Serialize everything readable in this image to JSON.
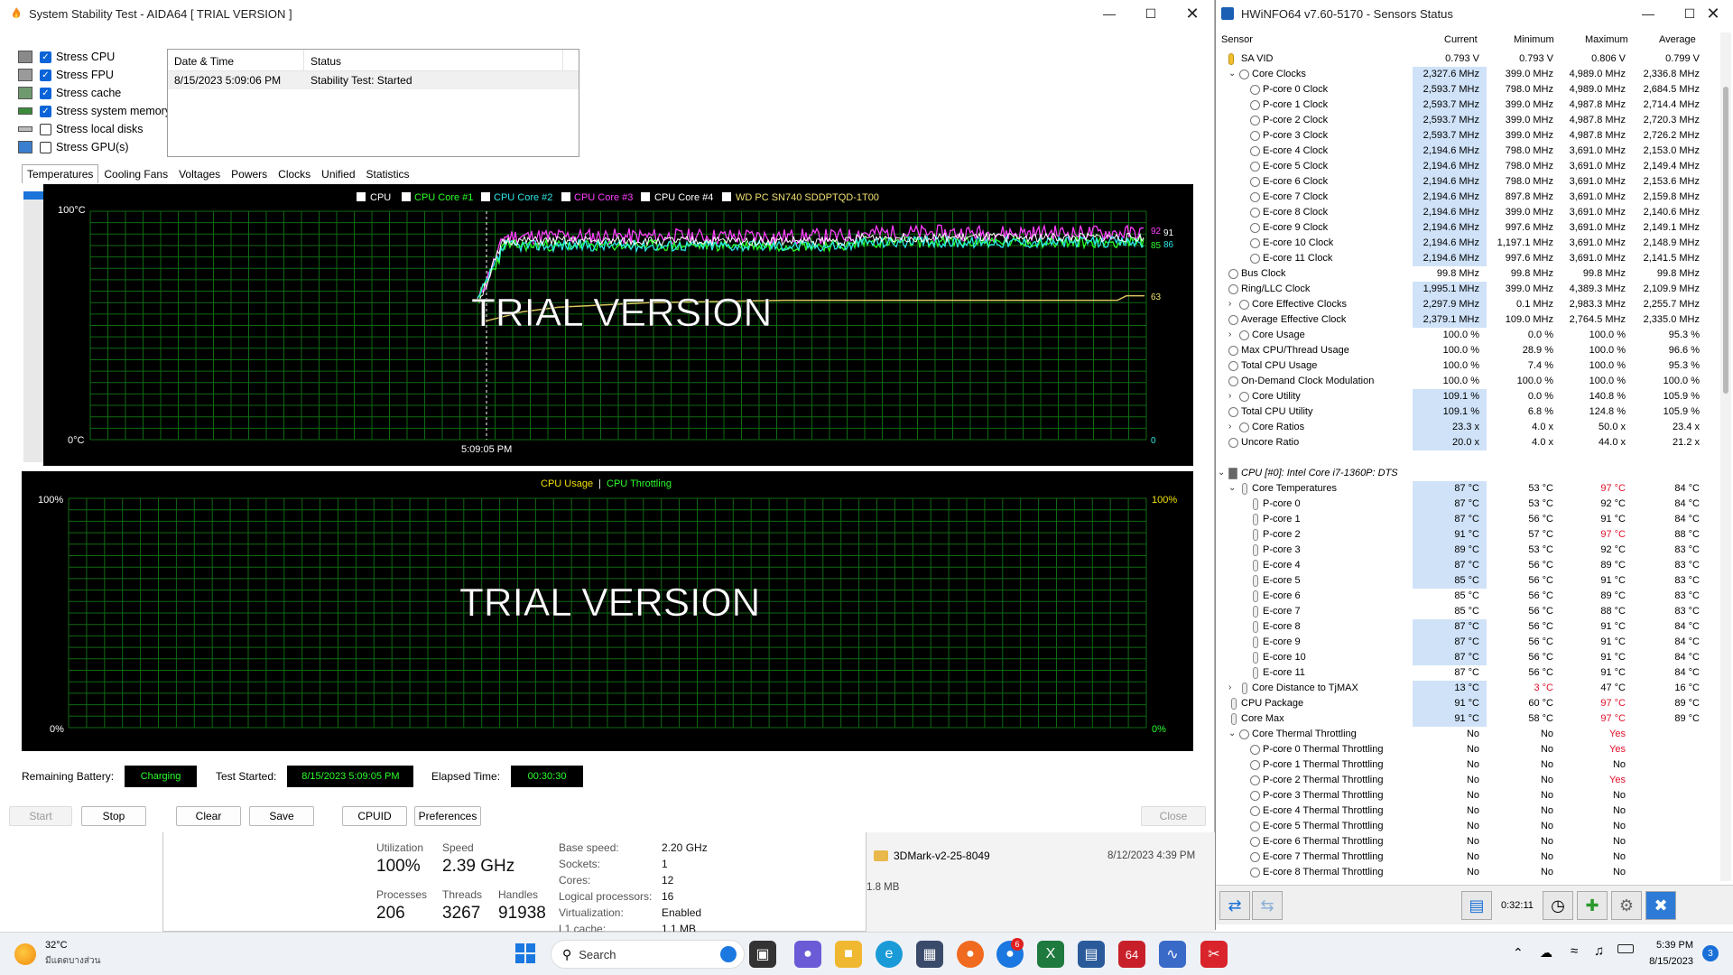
{
  "aida": {
    "title": "System Stability Test - AIDA64  [ TRIAL VERSION ]",
    "stress": [
      {
        "label": "Stress CPU",
        "checked": true
      },
      {
        "label": "Stress FPU",
        "checked": true
      },
      {
        "label": "Stress cache",
        "checked": true
      },
      {
        "label": "Stress system memory",
        "checked": true
      },
      {
        "label": "Stress local disks",
        "checked": false
      },
      {
        "label": "Stress GPU(s)",
        "checked": false
      }
    ],
    "log": {
      "col1": "Date & Time",
      "col2": "Status",
      "row_date": "8/15/2023 5:09:06 PM",
      "row_status": "Stability Test: Started"
    },
    "tabs": [
      "Temperatures",
      "Cooling Fans",
      "Voltages",
      "Powers",
      "Clocks",
      "Unified",
      "Statistics"
    ],
    "graph1": {
      "legend": [
        "CPU",
        "CPU Core #1",
        "CPU Core #2",
        "CPU Core #3",
        "CPU Core #4",
        "WD PC SN740 SDDPTQD-1T00"
      ],
      "legend_colors": [
        "#ffffff",
        "#2bff2b",
        "#2ee6e6",
        "#ff40ff",
        "#ffffff",
        "#f0e070"
      ],
      "y_top": "100°C",
      "y_bottom": "0°C",
      "x_label": "5:09:05 PM",
      "right_labels": {
        "a": "92",
        "b": "91",
        "c": "85",
        "d": "86",
        "e": "63",
        "f": "0"
      },
      "watermark": "TRIAL VERSION"
    },
    "graph2": {
      "legend_a": "CPU Usage",
      "legend_sep": "|",
      "legend_b": "CPU Throttling",
      "y_top_left": "100%",
      "y_bottom_left": "0%",
      "y_top_right": "100%",
      "y_bottom_right": "0%",
      "watermark": "TRIAL VERSION"
    },
    "status": {
      "battery_label": "Remaining Battery:",
      "battery_value": "Charging",
      "started_label": "Test Started:",
      "started_value": "8/15/2023 5:09:05 PM",
      "elapsed_label": "Elapsed Time:",
      "elapsed_value": "00:30:30"
    },
    "buttons": {
      "start": "Start",
      "stop": "Stop",
      "clear": "Clear",
      "save": "Save",
      "cpuid": "CPUID",
      "preferences": "Preferences",
      "close": "Close"
    }
  },
  "taskmgr": {
    "utilization_label": "Utilization",
    "utilization": "100%",
    "speed_label": "Speed",
    "speed": "2.39 GHz",
    "processes_label": "Processes",
    "processes": "206",
    "threads_label": "Threads",
    "threads": "3267",
    "handles_label": "Handles",
    "handles": "91938",
    "base_speed_k": "Base speed:",
    "base_speed_v": "2.20 GHz",
    "sockets_k": "Sockets:",
    "sockets_v": "1",
    "cores_k": "Cores:",
    "cores_v": "12",
    "logical_k": "Logical processors:",
    "logical_v": "16",
    "virt_k": "Virtualization:",
    "virt_v": "Enabled",
    "l1_k": "L1 cache:",
    "l1_v": "1.1 MB"
  },
  "explorer": {
    "file_name": "3DMark-v2-25-8049",
    "file_date": "8/12/2023 4:39 PM",
    "size": "1.8 MB"
  },
  "hwinfo": {
    "title": "HWiNFO64 v7.60-5170 - Sensors Status",
    "headers": {
      "sensor": "Sensor",
      "current": "Current",
      "minimum": "Minimum",
      "maximum": "Maximum",
      "average": "Average"
    },
    "rows": [
      {
        "n": "SA VID",
        "c": "0.793 V",
        "mi": "0.793 V",
        "ma": "0.806 V",
        "a": "0.799 V",
        "ind": 0,
        "t": "v"
      },
      {
        "n": "Core Clocks",
        "c": "2,327.6 MHz",
        "mi": "399.0 MHz",
        "ma": "4,989.0 MHz",
        "a": "2,336.8 MHz",
        "ind": 1,
        "t": "s",
        "e": "v",
        "hl": true
      },
      {
        "n": "P-core 0 Clock",
        "c": "2,593.7 MHz",
        "mi": "798.0 MHz",
        "ma": "4,989.0 MHz",
        "a": "2,684.5 MHz",
        "ind": 2,
        "t": "s",
        "hl": true
      },
      {
        "n": "P-core 1 Clock",
        "c": "2,593.7 MHz",
        "mi": "399.0 MHz",
        "ma": "4,987.8 MHz",
        "a": "2,714.4 MHz",
        "ind": 2,
        "t": "s",
        "hl": true
      },
      {
        "n": "P-core 2 Clock",
        "c": "2,593.7 MHz",
        "mi": "399.0 MHz",
        "ma": "4,987.8 MHz",
        "a": "2,720.3 MHz",
        "ind": 2,
        "t": "s",
        "hl": true
      },
      {
        "n": "P-core 3 Clock",
        "c": "2,593.7 MHz",
        "mi": "399.0 MHz",
        "ma": "4,987.8 MHz",
        "a": "2,726.2 MHz",
        "ind": 2,
        "t": "s",
        "hl": true
      },
      {
        "n": "E-core 4 Clock",
        "c": "2,194.6 MHz",
        "mi": "798.0 MHz",
        "ma": "3,691.0 MHz",
        "a": "2,153.0 MHz",
        "ind": 2,
        "t": "s",
        "hl": true
      },
      {
        "n": "E-core 5 Clock",
        "c": "2,194.6 MHz",
        "mi": "798.0 MHz",
        "ma": "3,691.0 MHz",
        "a": "2,149.4 MHz",
        "ind": 2,
        "t": "s",
        "hl": true
      },
      {
        "n": "E-core 6 Clock",
        "c": "2,194.6 MHz",
        "mi": "798.0 MHz",
        "ma": "3,691.0 MHz",
        "a": "2,153.6 MHz",
        "ind": 2,
        "t": "s",
        "hl": true
      },
      {
        "n": "E-core 7 Clock",
        "c": "2,194.6 MHz",
        "mi": "897.8 MHz",
        "ma": "3,691.0 MHz",
        "a": "2,159.8 MHz",
        "ind": 2,
        "t": "s",
        "hl": true
      },
      {
        "n": "E-core 8 Clock",
        "c": "2,194.6 MHz",
        "mi": "399.0 MHz",
        "ma": "3,691.0 MHz",
        "a": "2,140.6 MHz",
        "ind": 2,
        "t": "s",
        "hl": true
      },
      {
        "n": "E-core 9 Clock",
        "c": "2,194.6 MHz",
        "mi": "997.6 MHz",
        "ma": "3,691.0 MHz",
        "a": "2,149.1 MHz",
        "ind": 2,
        "t": "s",
        "hl": true
      },
      {
        "n": "E-core 10 Clock",
        "c": "2,194.6 MHz",
        "mi": "1,197.1 MHz",
        "ma": "3,691.0 MHz",
        "a": "2,148.9 MHz",
        "ind": 2,
        "t": "s",
        "hl": true
      },
      {
        "n": "E-core 11 Clock",
        "c": "2,194.6 MHz",
        "mi": "997.6 MHz",
        "ma": "3,691.0 MHz",
        "a": "2,141.5 MHz",
        "ind": 2,
        "t": "s",
        "hl": true
      },
      {
        "n": "Bus Clock",
        "c": "99.8 MHz",
        "mi": "99.8 MHz",
        "ma": "99.8 MHz",
        "a": "99.8 MHz",
        "ind": 0,
        "t": "s"
      },
      {
        "n": "Ring/LLC Clock",
        "c": "1,995.1 MHz",
        "mi": "399.0 MHz",
        "ma": "4,389.3 MHz",
        "a": "2,109.9 MHz",
        "ind": 0,
        "t": "s",
        "hl": true
      },
      {
        "n": "Core Effective Clocks",
        "c": "2,297.9 MHz",
        "mi": "0.1 MHz",
        "ma": "2,983.3 MHz",
        "a": "2,255.7 MHz",
        "ind": 1,
        "t": "s",
        "e": ">",
        "hl": true
      },
      {
        "n": "Average Effective Clock",
        "c": "2,379.1 MHz",
        "mi": "109.0 MHz",
        "ma": "2,764.5 MHz",
        "a": "2,335.0 MHz",
        "ind": 0,
        "t": "s",
        "hl": true
      },
      {
        "n": "Core Usage",
        "c": "100.0 %",
        "mi": "0.0 %",
        "ma": "100.0 %",
        "a": "95.3 %",
        "ind": 1,
        "t": "s",
        "e": ">"
      },
      {
        "n": "Max CPU/Thread Usage",
        "c": "100.0 %",
        "mi": "28.9 %",
        "ma": "100.0 %",
        "a": "96.6 %",
        "ind": 0,
        "t": "s"
      },
      {
        "n": "Total CPU Usage",
        "c": "100.0 %",
        "mi": "7.4 %",
        "ma": "100.0 %",
        "a": "95.3 %",
        "ind": 0,
        "t": "s"
      },
      {
        "n": "On-Demand Clock Modulation",
        "c": "100.0 %",
        "mi": "100.0 %",
        "ma": "100.0 %",
        "a": "100.0 %",
        "ind": 0,
        "t": "s"
      },
      {
        "n": "Core Utility",
        "c": "109.1 %",
        "mi": "0.0 %",
        "ma": "140.8 %",
        "a": "105.9 %",
        "ind": 1,
        "t": "s",
        "e": ">",
        "hl": true
      },
      {
        "n": "Total CPU Utility",
        "c": "109.1 %",
        "mi": "6.8 %",
        "ma": "124.8 %",
        "a": "105.9 %",
        "ind": 0,
        "t": "s",
        "hl": true
      },
      {
        "n": "Core Ratios",
        "c": "23.3 x",
        "mi": "4.0 x",
        "ma": "50.0 x",
        "a": "23.4 x",
        "ind": 1,
        "t": "s",
        "e": ">",
        "hl": true
      },
      {
        "n": "Uncore Ratio",
        "c": "20.0 x",
        "mi": "4.0 x",
        "ma": "44.0 x",
        "a": "21.2 x",
        "ind": 0,
        "t": "s",
        "hl": true
      },
      {
        "n": "",
        "c": "",
        "mi": "",
        "ma": "",
        "a": "",
        "ind": 0,
        "t": "blank"
      },
      {
        "n": "CPU [#0]: Intel Core i7-1360P: DTS",
        "c": "",
        "mi": "",
        "ma": "",
        "a": "",
        "ind": 0,
        "t": "grp",
        "e": "v"
      },
      {
        "n": "Core Temperatures",
        "c": "87 °C",
        "mi": "53 °C",
        "ma": "97 °C",
        "a": "84 °C",
        "ind": 1,
        "t": "t",
        "e": "v",
        "hl": true,
        "rmax": true
      },
      {
        "n": "P-core 0",
        "c": "87 °C",
        "mi": "53 °C",
        "ma": "92 °C",
        "a": "84 °C",
        "ind": 2,
        "t": "t",
        "hl": true
      },
      {
        "n": "P-core 1",
        "c": "87 °C",
        "mi": "56 °C",
        "ma": "91 °C",
        "a": "84 °C",
        "ind": 2,
        "t": "t",
        "hl": true
      },
      {
        "n": "P-core 2",
        "c": "91 °C",
        "mi": "57 °C",
        "ma": "97 °C",
        "a": "88 °C",
        "ind": 2,
        "t": "t",
        "hl": true,
        "rmax": true
      },
      {
        "n": "P-core 3",
        "c": "89 °C",
        "mi": "53 °C",
        "ma": "92 °C",
        "a": "83 °C",
        "ind": 2,
        "t": "t",
        "hl": true
      },
      {
        "n": "E-core 4",
        "c": "87 °C",
        "mi": "56 °C",
        "ma": "89 °C",
        "a": "83 °C",
        "ind": 2,
        "t": "t",
        "hl": true
      },
      {
        "n": "E-core 5",
        "c": "85 °C",
        "mi": "56 °C",
        "ma": "91 °C",
        "a": "83 °C",
        "ind": 2,
        "t": "t",
        "hl": true
      },
      {
        "n": "E-core 6",
        "c": "85 °C",
        "mi": "56 °C",
        "ma": "89 °C",
        "a": "83 °C",
        "ind": 2,
        "t": "t"
      },
      {
        "n": "E-core 7",
        "c": "85 °C",
        "mi": "56 °C",
        "ma": "88 °C",
        "a": "83 °C",
        "ind": 2,
        "t": "t"
      },
      {
        "n": "E-core 8",
        "c": "87 °C",
        "mi": "56 °C",
        "ma": "91 °C",
        "a": "84 °C",
        "ind": 2,
        "t": "t",
        "hl": true
      },
      {
        "n": "E-core 9",
        "c": "87 °C",
        "mi": "56 °C",
        "ma": "91 °C",
        "a": "84 °C",
        "ind": 2,
        "t": "t",
        "hl": true
      },
      {
        "n": "E-core 10",
        "c": "87 °C",
        "mi": "56 °C",
        "ma": "91 °C",
        "a": "84 °C",
        "ind": 2,
        "t": "t",
        "hl": true
      },
      {
        "n": "E-core 11",
        "c": "87 °C",
        "mi": "56 °C",
        "ma": "91 °C",
        "a": "84 °C",
        "ind": 2,
        "t": "t"
      },
      {
        "n": "Core Distance to TjMAX",
        "c": "13 °C",
        "mi": "3 °C",
        "ma": "47 °C",
        "a": "16 °C",
        "ind": 1,
        "t": "t",
        "e": ">",
        "hl": true,
        "rmin": true
      },
      {
        "n": "CPU Package",
        "c": "91 °C",
        "mi": "60 °C",
        "ma": "97 °C",
        "a": "89 °C",
        "ind": 0,
        "t": "t",
        "hl": true,
        "rmax": true
      },
      {
        "n": "Core Max",
        "c": "91 °C",
        "mi": "58 °C",
        "ma": "97 °C",
        "a": "89 °C",
        "ind": 0,
        "t": "t",
        "hl": true,
        "rmax": true
      },
      {
        "n": "Core Thermal Throttling",
        "c": "No",
        "mi": "No",
        "ma": "Yes",
        "a": "",
        "ind": 1,
        "t": "s",
        "e": "v",
        "rmax": true
      },
      {
        "n": "P-core 0 Thermal Throttling",
        "c": "No",
        "mi": "No",
        "ma": "Yes",
        "a": "",
        "ind": 2,
        "t": "s",
        "rmax": true
      },
      {
        "n": "P-core 1 Thermal Throttling",
        "c": "No",
        "mi": "No",
        "ma": "No",
        "a": "",
        "ind": 2,
        "t": "s"
      },
      {
        "n": "P-core 2 Thermal Throttling",
        "c": "No",
        "mi": "No",
        "ma": "Yes",
        "a": "",
        "ind": 2,
        "t": "s",
        "rmax": true
      },
      {
        "n": "P-core 3 Thermal Throttling",
        "c": "No",
        "mi": "No",
        "ma": "No",
        "a": "",
        "ind": 2,
        "t": "s"
      },
      {
        "n": "E-core 4 Thermal Throttling",
        "c": "No",
        "mi": "No",
        "ma": "No",
        "a": "",
        "ind": 2,
        "t": "s"
      },
      {
        "n": "E-core 5 Thermal Throttling",
        "c": "No",
        "mi": "No",
        "ma": "No",
        "a": "",
        "ind": 2,
        "t": "s"
      },
      {
        "n": "E-core 6 Thermal Throttling",
        "c": "No",
        "mi": "No",
        "ma": "No",
        "a": "",
        "ind": 2,
        "t": "s"
      },
      {
        "n": "E-core 7 Thermal Throttling",
        "c": "No",
        "mi": "No",
        "ma": "No",
        "a": "",
        "ind": 2,
        "t": "s"
      },
      {
        "n": "E-core 8 Thermal Throttling",
        "c": "No",
        "mi": "No",
        "ma": "No",
        "a": "",
        "ind": 2,
        "t": "s"
      }
    ],
    "timer": "0:32:11"
  },
  "taskbar": {
    "weather_temp": "32°C",
    "weather_desc": "มีแดดบางส่วน",
    "search": "Search",
    "time": "5:39 PM",
    "date": "8/15/2023",
    "edge_badge": "6",
    "notif_badge": "3"
  }
}
